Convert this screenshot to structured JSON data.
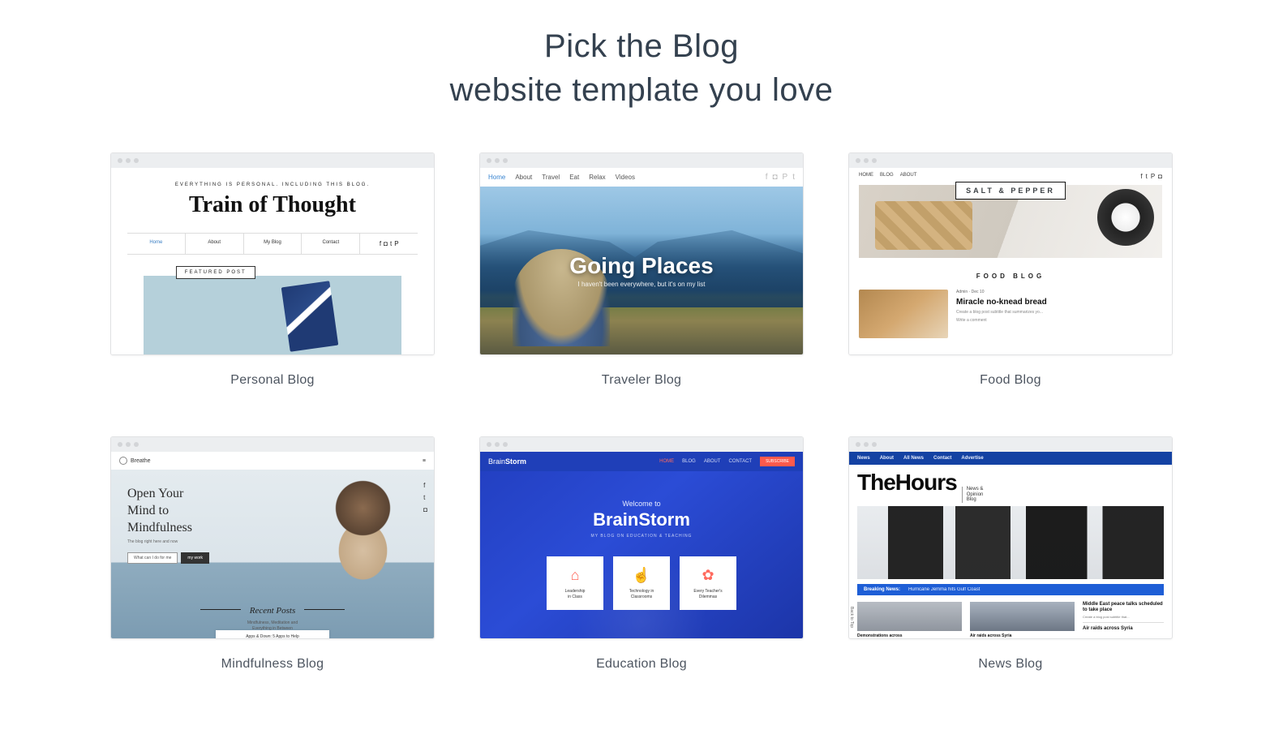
{
  "header": {
    "title_line1": "Pick the Blog",
    "title_line2": "website template you love"
  },
  "templates": [
    {
      "label": "Personal Blog",
      "tagline": "EVERYTHING IS PERSONAL. INCLUDING THIS BLOG.",
      "title": "Train of Thought",
      "nav": {
        "home": "Home",
        "about": "About",
        "myblog": "My Blog",
        "contact": "Contact"
      },
      "featured": "FEATURED POST"
    },
    {
      "label": "Traveler Blog",
      "nav": {
        "home": "Home",
        "about": "About",
        "travel": "Travel",
        "eat": "Eat",
        "relax": "Relax",
        "videos": "Videos"
      },
      "hero_title": "Going Places",
      "hero_sub": "I haven't been everywhere, but it's on my list"
    },
    {
      "label": "Food Blog",
      "nav": {
        "home": "HOME",
        "blog": "BLOG",
        "about": "ABOUT"
      },
      "logo": "SALT & PEPPER",
      "tagline": "FOOD BLOG",
      "post": {
        "author": "Admin",
        "date": "Dec 10",
        "title": "Miracle no-knead bread",
        "subtitle": "Create a blog post subtitle that summarizes yo...",
        "like": "Write a comment"
      }
    },
    {
      "label": "Mindfulness Blog",
      "brand": "Breathe",
      "hero_title": "Open Your\nMind to\nMindfulness",
      "hero_sub": "The blog right here and now",
      "btn1": "What can I do for me",
      "btn2": "my work",
      "recent_title": "Recent Posts",
      "recent_sub": "Mindfulness, Meditation and\nEverything in Between",
      "card_title": "Apps & Down: 5 Apps to Help"
    },
    {
      "label": "Education Blog",
      "brand_a": "Brain",
      "brand_b": "Storm",
      "nav": {
        "home": "HOME",
        "blog": "BLOG",
        "about": "ABOUT",
        "contact": "CONTACT"
      },
      "subscribe": "SUBSCRIBE",
      "welcome": "Welcome to",
      "title": "BrainStorm",
      "sub": "MY BLOG ON EDUCATION & TEACHING",
      "cards": [
        {
          "icon": "⌂",
          "text": "Leadership\nin Class"
        },
        {
          "icon": "☝",
          "text": "Technology in\nClassrooms"
        },
        {
          "icon": "✿",
          "text": "Every Teacher's\nDilemmas"
        }
      ]
    },
    {
      "label": "News Blog",
      "topnav": [
        "News",
        "About",
        "All News",
        "Contact",
        "Advertise"
      ],
      "title": "TheHours",
      "title_sub": "News &\nOpinion\nBlog",
      "breaking_label": "Breaking News:",
      "breaking_text": "Hurricane Jemma hits Gulf Coast",
      "thumbs": [
        "Demonstrations across",
        "Air raids across Syria"
      ],
      "side": [
        {
          "t": "Middle East peace talks scheduled to take place",
          "s": "Create a blog post subtitle that..."
        },
        {
          "t": "Air raids across Syria",
          "s": ""
        }
      ],
      "back_to_top": "Back to Top"
    }
  ]
}
